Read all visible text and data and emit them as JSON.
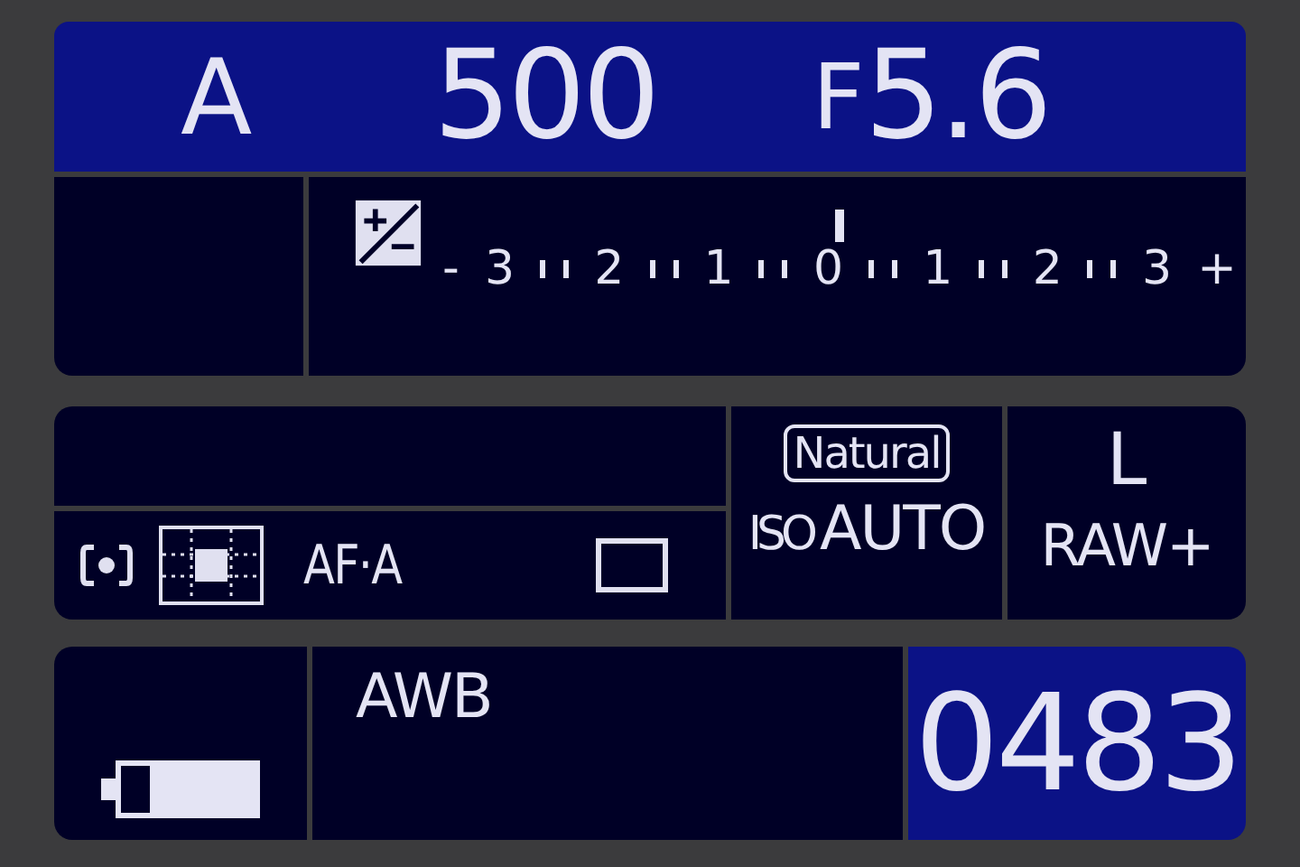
{
  "shooting": {
    "mode": "A",
    "shutter": "500",
    "aperture_prefix": "F",
    "aperture": "5.6"
  },
  "exposure": {
    "scale": [
      "-",
      "3",
      "2",
      "1",
      "0",
      "1",
      "2",
      "3",
      "+"
    ]
  },
  "settings": {
    "af_mode": "AF·A",
    "picture_control": "Natural",
    "iso_label": "ISO",
    "iso": "AUTO",
    "image_size": "L",
    "quality": "RAW+"
  },
  "battery": {
    "level": 0.78
  },
  "white_balance": "AWB",
  "shots_remaining": "0483"
}
